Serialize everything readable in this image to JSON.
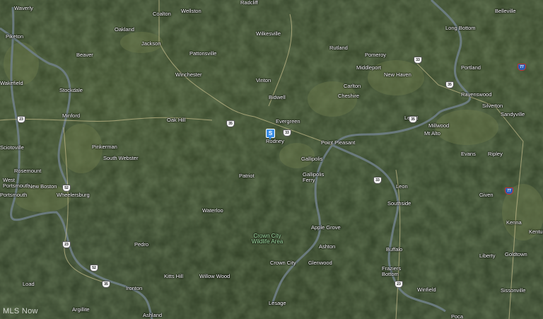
{
  "watermark": "MLS Now",
  "pin": {
    "label": "S",
    "color": "#3a8ee6"
  },
  "places": [
    {
      "name": "Waverly"
    },
    {
      "name": "Coalton"
    },
    {
      "name": "Wellston"
    },
    {
      "name": "Radcliff"
    },
    {
      "name": "Belleville"
    },
    {
      "name": "Oakland"
    },
    {
      "name": "Wilkesville"
    },
    {
      "name": "Long Bottom"
    },
    {
      "name": "Piketon"
    },
    {
      "name": "Jackson"
    },
    {
      "name": "Pattonsville"
    },
    {
      "name": "Rutland"
    },
    {
      "name": "Pomeroy"
    },
    {
      "name": "Beaver"
    },
    {
      "name": "Middleport"
    },
    {
      "name": "New Haven"
    },
    {
      "name": "Portland"
    },
    {
      "name": "Wakefield"
    },
    {
      "name": "Winchester"
    },
    {
      "name": "Vinton"
    },
    {
      "name": "Carlton"
    },
    {
      "name": "Stockdale"
    },
    {
      "name": "Cheshire"
    },
    {
      "name": "Ravenswood"
    },
    {
      "name": "Bidwell"
    },
    {
      "name": "Silverton"
    },
    {
      "name": "Minford"
    },
    {
      "name": "Oak Hill"
    },
    {
      "name": "Evergreen"
    },
    {
      "name": "Letart"
    },
    {
      "name": "Sandyville"
    },
    {
      "name": "Millwood"
    },
    {
      "name": "Mt Alto"
    },
    {
      "name": "Rodney"
    },
    {
      "name": "Point Pleasant"
    },
    {
      "name": "Pinkerman"
    },
    {
      "name": "South Webster"
    },
    {
      "name": "Evans"
    },
    {
      "name": "Ripley"
    },
    {
      "name": "Gallipolis"
    },
    {
      "name": "Rosemount"
    },
    {
      "name": "Patriot"
    },
    {
      "name": "Gallipolis Ferry"
    },
    {
      "name": "West Portsmouth"
    },
    {
      "name": "New Boston"
    },
    {
      "name": "Portsmouth"
    },
    {
      "name": "Wheelersburg"
    },
    {
      "name": "Leon"
    },
    {
      "name": "Given"
    },
    {
      "name": "Waterloo"
    },
    {
      "name": "Southside"
    },
    {
      "name": "Kenna"
    },
    {
      "name": "Apple Grove"
    },
    {
      "name": "Kentuck"
    },
    {
      "name": "Pedro"
    },
    {
      "name": "Ashton"
    },
    {
      "name": "Buffalo"
    },
    {
      "name": "Goldtown"
    },
    {
      "name": "Liberty"
    },
    {
      "name": "Crown City"
    },
    {
      "name": "Glenwood"
    },
    {
      "name": "Kitts Hill"
    },
    {
      "name": "Willow Wood"
    },
    {
      "name": "Fraziers Bottom"
    },
    {
      "name": "Load"
    },
    {
      "name": "Ironton"
    },
    {
      "name": "Winfield"
    },
    {
      "name": "Sissonville"
    },
    {
      "name": "Argillite"
    },
    {
      "name": "Lesage"
    },
    {
      "name": "Ashland"
    },
    {
      "name": "Poca"
    },
    {
      "name": "Sciotoville"
    }
  ],
  "area_label": "Crown City Wildlife Area",
  "shields": [
    {
      "route": "35",
      "type": "us"
    },
    {
      "route": "33",
      "type": "us"
    },
    {
      "route": "33",
      "type": "us"
    },
    {
      "route": "77",
      "type": "interstate"
    },
    {
      "route": "23",
      "type": "us"
    },
    {
      "route": "35",
      "type": "us"
    },
    {
      "route": "52",
      "type": "us"
    },
    {
      "route": "35",
      "type": "us"
    },
    {
      "route": "33",
      "type": "us"
    },
    {
      "route": "77",
      "type": "interstate"
    },
    {
      "route": "23",
      "type": "us"
    },
    {
      "route": "52",
      "type": "us"
    },
    {
      "route": "35",
      "type": "us"
    },
    {
      "route": "23",
      "type": "us"
    }
  ]
}
